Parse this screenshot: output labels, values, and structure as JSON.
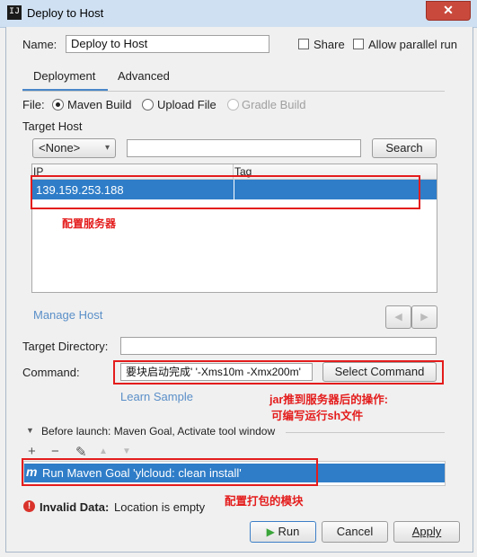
{
  "window": {
    "title": "Deploy to Host",
    "app_icon": "IJ",
    "close_glyph": "✕"
  },
  "form": {
    "name_label": "Name:",
    "name_value": "Deploy to Host",
    "share_label": "Share",
    "allow_parallel_label": "Allow parallel run"
  },
  "tabs": [
    {
      "label": "Deployment",
      "active": true
    },
    {
      "label": "Advanced",
      "active": false
    }
  ],
  "file": {
    "label": "File:",
    "options": [
      {
        "label": "Maven Build",
        "selected": true,
        "enabled": true
      },
      {
        "label": "Upload File",
        "selected": false,
        "enabled": true
      },
      {
        "label": "Gradle Build",
        "selected": false,
        "enabled": false
      }
    ]
  },
  "target_host": {
    "label": "Target Host",
    "select_value": "<None>",
    "search_value": "",
    "search_button": "Search",
    "columns": [
      "IP",
      "Tag"
    ],
    "rows": [
      {
        "ip": "139.159.253.188",
        "tag": ""
      }
    ],
    "manage_host_link": "Manage Host"
  },
  "target_directory": {
    "label": "Target Directory:",
    "value": ""
  },
  "command": {
    "label": "Command:",
    "value": "要块启动完成' '-Xms10m -Xmx200m'",
    "select_button": "Select Command",
    "learn_link": "Learn Sample"
  },
  "before_launch": {
    "header": "Before launch: Maven Goal, Activate tool window",
    "tools": {
      "add": "+",
      "remove": "−",
      "edit": "✎",
      "up": "▲",
      "down": "▼"
    },
    "items": [
      {
        "icon_letter": "m",
        "label": "Run Maven Goal 'ylcloud: clean install'"
      }
    ]
  },
  "error": {
    "icon": "!",
    "title": "Invalid Data:",
    "message": "Location is empty"
  },
  "buttons": {
    "run": "Run",
    "cancel": "Cancel",
    "apply": "Apply"
  },
  "annotations": {
    "server": "配置服务器",
    "command_line1": "jar推到服务器后的操作:",
    "command_line2": "可编写运行sh文件",
    "module": "配置打包的模块"
  },
  "colors": {
    "accent": "#2f7dc8",
    "annotation": "#e41c1c",
    "link": "#5a8fc8",
    "run_icon": "#3aa53a"
  }
}
